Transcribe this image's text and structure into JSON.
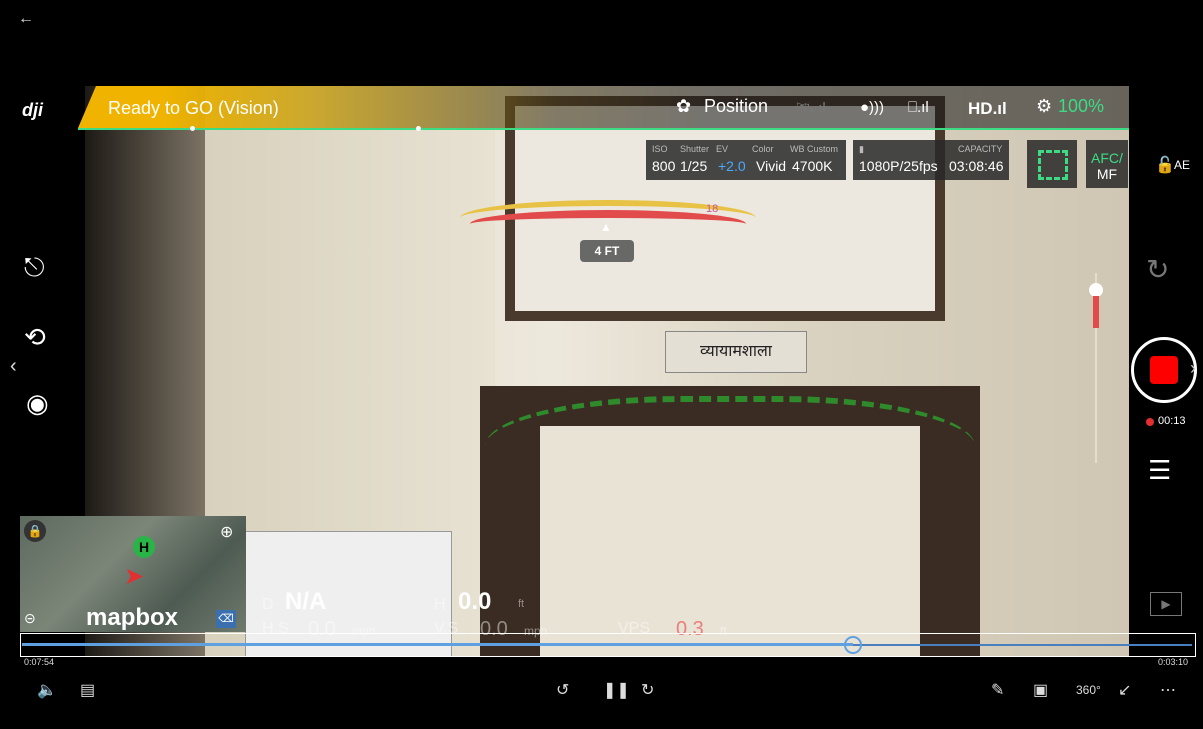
{
  "nav": {
    "back_icon": "arrow-left-icon"
  },
  "brand": {
    "logo": "dji"
  },
  "status": {
    "text": "Ready to GO (Vision)"
  },
  "topbar": {
    "flight_mode": "Position",
    "hd_label": "HD",
    "battery": "100%",
    "battery_color": "#3ddc84"
  },
  "camera": {
    "iso_label": "ISO",
    "shutter_label": "Shutter",
    "ev_label": "EV",
    "color_label": "Color",
    "wb_label": "WB Custom",
    "iso": "800",
    "shutter": "1/25",
    "ev": "+2.0",
    "color": "Vivid",
    "wb": "4700K",
    "capacity_label": "CAPACITY",
    "resolution": "1080P/25fps",
    "capacity": "03:08:46",
    "focus_top": "AFC/",
    "focus_bottom": "MF",
    "ae_label": "AE"
  },
  "obstacle": {
    "distance": "4 FT",
    "marker": "18"
  },
  "sign": {
    "text": "व्यायामशाला"
  },
  "recording": {
    "time": "00:13",
    "rec_color": "#ff0000"
  },
  "map": {
    "brand": "mapbox",
    "home_marker": "H"
  },
  "telemetry": {
    "d_label": "D",
    "d_value": "N/A",
    "h_label": "H",
    "h_value": "0.0",
    "h_unit": "ft",
    "hs_label": "H.S",
    "hs_value": "0.0",
    "hs_unit": "mph",
    "vs_label": "V.S",
    "vs_value": "0.0",
    "vs_unit": "mph",
    "vps_label": "VPS",
    "vps_value": "0.3",
    "vps_unit": "ft"
  },
  "player": {
    "elapsed": "0:07:54",
    "remaining": "0:03:10",
    "progress": 0.71
  }
}
